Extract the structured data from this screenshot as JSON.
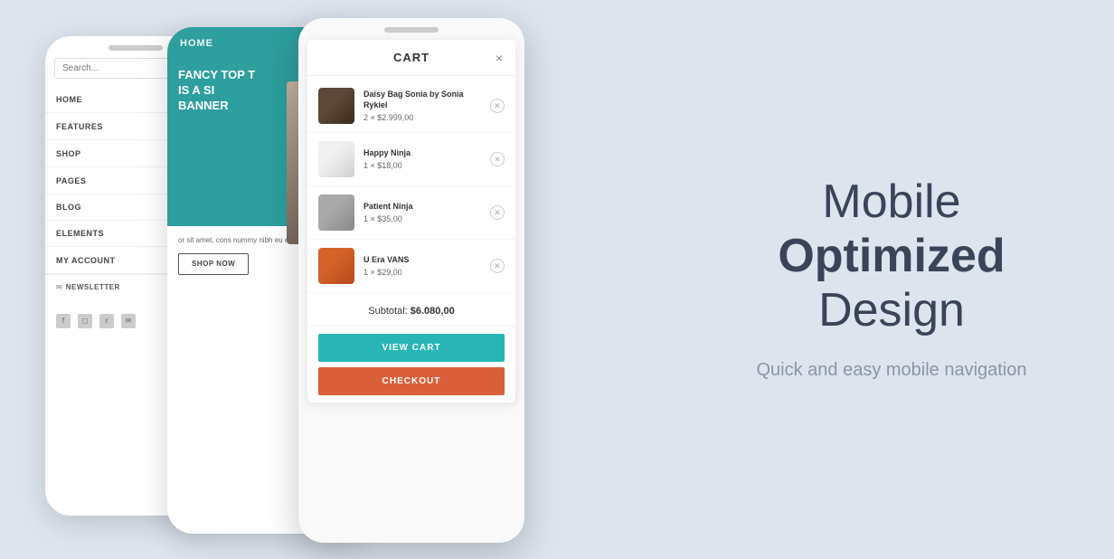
{
  "page": {
    "background": "#dde4ed"
  },
  "phones": {
    "back": {
      "search_placeholder": "Search...",
      "nav_items": [
        {
          "label": "HOME",
          "has_chevron": true
        },
        {
          "label": "FEATURES",
          "has_chevron": true
        },
        {
          "label": "SHOP",
          "has_chevron": true
        },
        {
          "label": "PAGES",
          "has_chevron": true
        },
        {
          "label": "BLOG",
          "has_chevron": false
        },
        {
          "label": "ELEMENTS",
          "has_chevron": false
        },
        {
          "label": "MY ACCOUNT",
          "has_chevron": true
        }
      ],
      "newsletter_label": "NEWSLETTER"
    },
    "mid": {
      "title": "HOME",
      "banner_line1": "Fancy Top T",
      "banner_line2": "IS A SI",
      "banner_line3": "BANNER",
      "body_text": "or sit amet, cons nummy nibh eu e magna aliqu",
      "shop_now": "SHOP NOW"
    },
    "front": {
      "cart_title": "CART",
      "close_icon": "×",
      "items": [
        {
          "name": "Daisy Bag Sonia by Sonia Rykiel",
          "qty": 2,
          "price": "$2.999,00",
          "img_class": "bag"
        },
        {
          "name": "Happy Ninja",
          "qty": 1,
          "price": "$18,00",
          "img_class": "shirt-white"
        },
        {
          "name": "Patient Ninja",
          "qty": 1,
          "price": "$35,00",
          "img_class": "hoodie"
        },
        {
          "name": "U Era VANS",
          "qty": 1,
          "price": "$29,00",
          "img_class": "pants"
        }
      ],
      "subtotal_label": "Subtotal:",
      "subtotal_value": "$6.080,00",
      "view_cart_label": "VIEW CART",
      "checkout_label": "CHECKOUT"
    }
  },
  "hero": {
    "line1": "Mobile",
    "line2": "Optimized",
    "line3": "Design",
    "subtitle": "Quick and easy mobile navigation"
  }
}
